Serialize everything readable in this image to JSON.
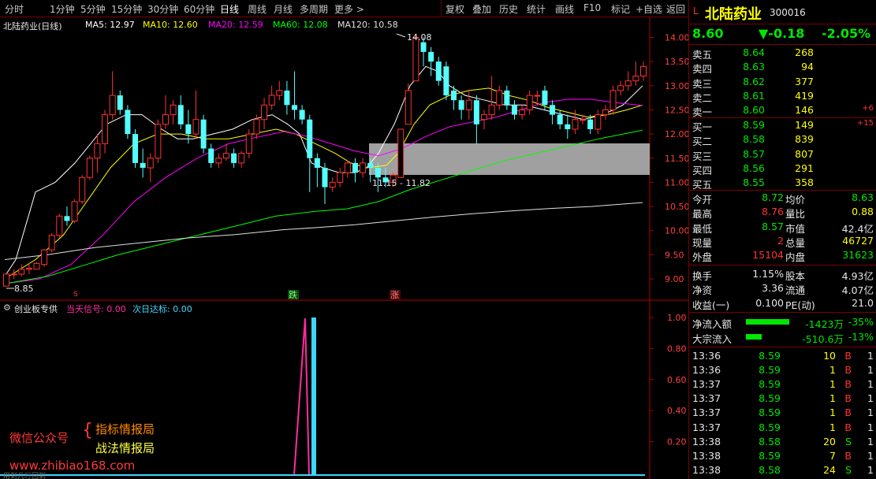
{
  "toolbar": {
    "periods": [
      "分时",
      "1分钟",
      "5分钟",
      "15分钟",
      "30分钟",
      "60分钟",
      "日线",
      "周线",
      "月线",
      "多周期",
      "更多 >"
    ],
    "active_period": "日线",
    "tools": [
      "复权",
      "叠加",
      "历史",
      "统计",
      "画线",
      "F10",
      "标记",
      "+自选",
      "返回"
    ]
  },
  "info": {
    "stock": "北陆药业(日线)",
    "ma5": "MA5: 12.97",
    "ma10": "MA10: 12.60",
    "ma20": "MA20: 12.59",
    "ma60": "MA60: 12.08",
    "ma120": "MA120: 10.58"
  },
  "chart_data": {
    "type": "candlestick",
    "y_ticks": [
      "14.00",
      "13.50",
      "13.00",
      "12.50",
      "12.00",
      "11.50",
      "11.00",
      "10.50",
      "10.00",
      "9.50",
      "9.00"
    ],
    "ind_ticks": [
      "1.00",
      "0.80",
      "0.60",
      "0.40",
      "0.20"
    ],
    "labels": {
      "high": "14.08",
      "low": "8.85",
      "zone": "11.15 - 11.82",
      "die": "跌",
      "zhang": "涨"
    },
    "zone": [
      11.15,
      11.82
    ],
    "candles": [
      [
        8.85,
        9.1,
        8.85,
        9.12
      ],
      [
        9.1,
        9.1,
        9.0,
        9.2
      ],
      [
        9.1,
        9.2,
        9.05,
        9.3
      ],
      [
        9.2,
        9.22,
        9.1,
        9.32
      ],
      [
        9.2,
        9.32,
        9.2,
        9.35
      ],
      [
        9.3,
        9.6,
        9.25,
        9.62
      ],
      [
        9.6,
        9.9,
        9.55,
        9.95
      ],
      [
        9.9,
        10.3,
        9.85,
        10.35
      ],
      [
        10.3,
        10.2,
        10.1,
        10.5
      ],
      [
        10.2,
        10.6,
        10.15,
        10.65
      ],
      [
        10.6,
        11.1,
        10.55,
        11.15
      ],
      [
        11.1,
        11.5,
        11.05,
        11.55
      ],
      [
        11.5,
        11.8,
        11.2,
        12.0
      ],
      [
        11.8,
        12.4,
        11.6,
        12.5
      ],
      [
        12.4,
        12.8,
        12.3,
        13.3
      ],
      [
        12.8,
        12.5,
        12.4,
        12.9
      ],
      [
        12.5,
        12.0,
        11.9,
        12.6
      ],
      [
        12.0,
        11.4,
        11.3,
        12.1
      ],
      [
        11.4,
        11.3,
        11.1,
        11.7
      ],
      [
        11.3,
        11.5,
        11.0,
        11.6
      ],
      [
        11.5,
        12.2,
        11.4,
        12.3
      ],
      [
        12.2,
        12.4,
        12.1,
        12.8
      ],
      [
        12.4,
        12.6,
        12.2,
        12.7
      ],
      [
        12.6,
        12.2,
        12.1,
        12.8
      ],
      [
        12.2,
        12.0,
        11.8,
        12.5
      ],
      [
        12.0,
        12.3,
        11.9,
        12.9
      ],
      [
        12.3,
        11.7,
        11.6,
        12.4
      ],
      [
        11.7,
        11.4,
        11.3,
        11.8
      ],
      [
        11.4,
        11.5,
        11.3,
        11.6
      ],
      [
        11.5,
        11.6,
        11.45,
        11.8
      ],
      [
        11.6,
        11.4,
        11.3,
        11.7
      ],
      [
        11.4,
        11.6,
        11.3,
        11.65
      ],
      [
        11.6,
        12.0,
        11.5,
        12.1
      ],
      [
        12.0,
        12.3,
        11.9,
        12.4
      ],
      [
        12.3,
        12.6,
        12.1,
        12.75
      ],
      [
        12.6,
        12.8,
        12.5,
        13.0
      ],
      [
        12.8,
        12.9,
        12.7,
        13.1
      ],
      [
        12.9,
        12.6,
        12.4,
        13.1
      ],
      [
        12.6,
        12.5,
        12.3,
        13.3
      ],
      [
        12.5,
        12.3,
        12.2,
        12.6
      ],
      [
        12.3,
        11.5,
        10.8,
        12.4
      ],
      [
        11.5,
        11.3,
        10.9,
        11.6
      ],
      [
        11.3,
        10.9,
        10.55,
        11.4
      ],
      [
        10.9,
        11.0,
        10.8,
        11.1
      ],
      [
        11.0,
        11.2,
        10.9,
        11.3
      ],
      [
        11.2,
        11.4,
        11.1,
        11.45
      ],
      [
        11.4,
        11.2,
        11.0,
        11.5
      ],
      [
        11.2,
        11.4,
        11.1,
        11.5
      ],
      [
        11.4,
        11.3,
        11.0,
        11.5
      ],
      [
        11.3,
        11.1,
        10.8,
        11.4
      ],
      [
        11.1,
        11.0,
        10.9,
        11.3
      ],
      [
        11.0,
        11.15,
        10.9,
        11.2
      ],
      [
        11.1,
        12.1,
        11.1,
        12.1
      ],
      [
        12.2,
        12.9,
        12.2,
        13.05
      ],
      [
        13.1,
        14.0,
        13.1,
        14.08
      ],
      [
        13.9,
        13.7,
        13.4,
        14.0
      ],
      [
        13.7,
        13.5,
        13.2,
        13.8
      ],
      [
        13.5,
        13.1,
        13.0,
        13.6
      ],
      [
        13.4,
        12.8,
        12.7,
        13.5
      ],
      [
        12.9,
        12.7,
        12.5,
        13.0
      ],
      [
        12.7,
        12.5,
        12.3,
        12.8
      ],
      [
        12.5,
        12.7,
        12.3,
        12.9
      ],
      [
        12.7,
        12.2,
        11.8,
        12.8
      ],
      [
        12.3,
        12.4,
        12.1,
        12.5
      ],
      [
        12.4,
        12.6,
        12.3,
        13.2
      ],
      [
        12.6,
        12.9,
        12.5,
        13.0
      ],
      [
        12.9,
        12.6,
        12.5,
        13.0
      ],
      [
        12.6,
        12.4,
        12.3,
        12.7
      ],
      [
        12.4,
        12.5,
        12.3,
        12.6
      ],
      [
        12.5,
        12.8,
        12.4,
        12.9
      ],
      [
        12.8,
        12.8,
        12.6,
        12.9
      ],
      [
        12.9,
        12.6,
        12.5,
        13.0
      ],
      [
        12.6,
        12.4,
        12.2,
        12.7
      ],
      [
        12.4,
        12.2,
        12.1,
        12.5
      ],
      [
        12.2,
        12.1,
        11.9,
        12.4
      ],
      [
        12.1,
        12.3,
        12.0,
        12.5
      ],
      [
        12.3,
        12.3,
        12.2,
        12.4
      ],
      [
        12.3,
        12.1,
        12.0,
        12.4
      ],
      [
        12.1,
        12.4,
        12.0,
        12.5
      ],
      [
        12.4,
        12.5,
        12.3,
        12.6
      ],
      [
        12.5,
        12.9,
        12.4,
        13.0
      ],
      [
        12.9,
        13.0,
        12.8,
        13.1
      ],
      [
        13.0,
        13.1,
        12.9,
        13.3
      ],
      [
        13.1,
        13.2,
        13.0,
        13.5
      ],
      [
        13.2,
        13.4,
        13.1,
        13.5
      ]
    ],
    "series": [
      {
        "name": "MA5",
        "color": "#ffffff",
        "values": [
          [
            6,
            9.05
          ],
          [
            20,
            9.4
          ],
          [
            45,
            10.8
          ],
          [
            70,
            11.0
          ],
          [
            95,
            11.4
          ],
          [
            135,
            12.2
          ],
          [
            160,
            12.4
          ],
          [
            180,
            12.4
          ],
          [
            205,
            12.1
          ],
          [
            225,
            11.9
          ],
          [
            245,
            11.9
          ],
          [
            270,
            12.0
          ],
          [
            295,
            12.1
          ],
          [
            320,
            12.3
          ],
          [
            345,
            12.4
          ],
          [
            365,
            12.2
          ],
          [
            380,
            12.0
          ],
          [
            395,
            11.4
          ],
          [
            410,
            11.3
          ],
          [
            430,
            11.2
          ],
          [
            450,
            11.2
          ],
          [
            465,
            11.3
          ],
          [
            480,
            11.6
          ],
          [
            500,
            12.2
          ],
          [
            520,
            13.0
          ],
          [
            540,
            13.4
          ],
          [
            555,
            13.3
          ],
          [
            570,
            13.0
          ],
          [
            590,
            12.8
          ],
          [
            615,
            12.7
          ],
          [
            640,
            12.6
          ],
          [
            665,
            12.6
          ],
          [
            690,
            12.5
          ],
          [
            715,
            12.4
          ],
          [
            740,
            12.3
          ],
          [
            765,
            12.4
          ],
          [
            790,
            12.6
          ],
          [
            815,
            13.0
          ]
        ]
      },
      {
        "name": "MA10",
        "color": "#ffff00",
        "values": [
          [
            6,
            9.0
          ],
          [
            45,
            9.4
          ],
          [
            80,
            9.9
          ],
          [
            110,
            10.6
          ],
          [
            140,
            11.3
          ],
          [
            170,
            11.8
          ],
          [
            200,
            12.0
          ],
          [
            230,
            12.0
          ],
          [
            260,
            11.9
          ],
          [
            290,
            11.9
          ],
          [
            320,
            12.0
          ],
          [
            350,
            12.1
          ],
          [
            375,
            12.0
          ],
          [
            400,
            11.8
          ],
          [
            425,
            11.6
          ],
          [
            445,
            11.4
          ],
          [
            465,
            11.3
          ],
          [
            490,
            11.35
          ],
          [
            505,
            11.6
          ],
          [
            525,
            12.2
          ],
          [
            545,
            12.6
          ],
          [
            570,
            12.8
          ],
          [
            595,
            12.9
          ],
          [
            620,
            12.95
          ],
          [
            645,
            12.8
          ],
          [
            670,
            12.7
          ],
          [
            695,
            12.55
          ],
          [
            720,
            12.45
          ],
          [
            745,
            12.35
          ],
          [
            770,
            12.4
          ],
          [
            795,
            12.5
          ],
          [
            815,
            12.6
          ]
        ]
      },
      {
        "name": "MA20",
        "color": "#ff00ff",
        "values": [
          [
            6,
            8.9
          ],
          [
            50,
            9.0
          ],
          [
            90,
            9.3
          ],
          [
            130,
            9.9
          ],
          [
            170,
            10.6
          ],
          [
            210,
            11.1
          ],
          [
            250,
            11.5
          ],
          [
            290,
            11.8
          ],
          [
            330,
            11.95
          ],
          [
            360,
            12.05
          ],
          [
            390,
            11.95
          ],
          [
            420,
            11.8
          ],
          [
            450,
            11.65
          ],
          [
            480,
            11.55
          ],
          [
            510,
            11.7
          ],
          [
            540,
            11.95
          ],
          [
            570,
            12.15
          ],
          [
            600,
            12.25
          ],
          [
            630,
            12.35
          ],
          [
            660,
            12.5
          ],
          [
            690,
            12.65
          ],
          [
            720,
            12.72
          ],
          [
            750,
            12.72
          ],
          [
            780,
            12.65
          ],
          [
            815,
            12.59
          ]
        ]
      },
      {
        "name": "MA60",
        "color": "#00ff00",
        "values": [
          [
            6,
            8.9
          ],
          [
            60,
            9.05
          ],
          [
            100,
            9.25
          ],
          [
            150,
            9.5
          ],
          [
            200,
            9.7
          ],
          [
            250,
            9.9
          ],
          [
            300,
            10.1
          ],
          [
            350,
            10.3
          ],
          [
            400,
            10.4
          ],
          [
            440,
            10.45
          ],
          [
            480,
            10.6
          ],
          [
            520,
            10.85
          ],
          [
            560,
            11.05
          ],
          [
            600,
            11.25
          ],
          [
            640,
            11.45
          ],
          [
            680,
            11.6
          ],
          [
            720,
            11.75
          ],
          [
            760,
            11.9
          ],
          [
            815,
            12.08
          ]
        ]
      },
      {
        "name": "MA120",
        "color": "#e0e0e0",
        "values": [
          [
            6,
            9.4
          ],
          [
            60,
            9.5
          ],
          [
            120,
            9.65
          ],
          [
            180,
            9.75
          ],
          [
            240,
            9.85
          ],
          [
            300,
            9.92
          ],
          [
            360,
            10.02
          ],
          [
            400,
            10.06
          ],
          [
            450,
            10.12
          ],
          [
            500,
            10.2
          ],
          [
            550,
            10.28
          ],
          [
            600,
            10.35
          ],
          [
            650,
            10.41
          ],
          [
            700,
            10.46
          ],
          [
            750,
            10.5
          ],
          [
            815,
            10.58
          ]
        ]
      }
    ]
  },
  "indicator": {
    "name": "创业板专供",
    "today_label": "当天信号: 0.00",
    "next_label": "次日达标: 0.00"
  },
  "watermark": {
    "line1": "微信公众号",
    "line2": "指标情报局",
    "line3": "战法情报局",
    "url": "www.zhibiao168.com",
    "tiny": "用到几行回到"
  },
  "quote": {
    "badge": "L",
    "name": "北陆药业",
    "code": "300016",
    "price": "8.60",
    "change": "▼-0.18",
    "change_pct": "-2.05%",
    "asks": [
      [
        "卖五",
        "8.64",
        "268",
        ""
      ],
      [
        "卖四",
        "8.63",
        "94",
        ""
      ],
      [
        "卖三",
        "8.62",
        "377",
        ""
      ],
      [
        "卖二",
        "8.61",
        "419",
        ""
      ],
      [
        "卖一",
        "8.60",
        "146",
        "+6"
      ]
    ],
    "bids": [
      [
        "买一",
        "8.59",
        "149",
        "+15"
      ],
      [
        "买二",
        "8.58",
        "839",
        ""
      ],
      [
        "买三",
        "8.57",
        "807",
        ""
      ],
      [
        "买四",
        "8.56",
        "291",
        ""
      ],
      [
        "买五",
        "8.55",
        "358",
        ""
      ]
    ],
    "stats": [
      [
        "今开",
        "8.72",
        "均价",
        "8.63"
      ],
      [
        "最高",
        "8.76",
        "量比",
        "0.88"
      ],
      [
        "最低",
        "8.57",
        "市值",
        "42.4亿"
      ],
      [
        "现量",
        "2",
        "总量",
        "46727"
      ],
      [
        "外盘",
        "15104",
        "内盘",
        "31623"
      ]
    ],
    "stats2": [
      [
        "换手",
        "1.15%",
        "股本",
        "4.93亿"
      ],
      [
        "净资",
        "3.36",
        "流通",
        "4.07亿"
      ],
      [
        "收益(一)",
        "0.100",
        "PE(动)",
        "21.0"
      ]
    ],
    "flows": [
      [
        "净流入额",
        "-1423万",
        "-35%",
        0.55
      ],
      [
        "大宗流入",
        "-510.6万",
        "-13%",
        0.2
      ]
    ],
    "ticks": [
      [
        "13:36",
        "8.59",
        "10",
        "B",
        "1"
      ],
      [
        "13:36",
        "8.59",
        "1",
        "B",
        "1"
      ],
      [
        "13:37",
        "8.59",
        "1",
        "B",
        "1"
      ],
      [
        "13:37",
        "8.59",
        "1",
        "B",
        "1"
      ],
      [
        "13:37",
        "8.59",
        "1",
        "B",
        "1"
      ],
      [
        "13:37",
        "8.59",
        "1",
        "B",
        "1"
      ],
      [
        "13:38",
        "8.58",
        "20",
        "S",
        "1"
      ],
      [
        "13:38",
        "8.59",
        "7",
        "B",
        "1"
      ],
      [
        "13:38",
        "8.58",
        "24",
        "S",
        "1"
      ]
    ]
  }
}
